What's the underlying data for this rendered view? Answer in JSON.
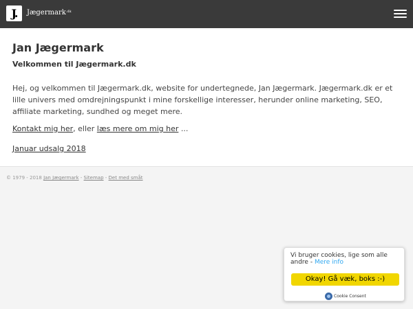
{
  "header": {
    "logo_text": "J.",
    "brand": "Jægermark",
    "brand_suffix": ".dk",
    "menu_icon": "hamburger-icon"
  },
  "main": {
    "title": "Jan Jægermark",
    "subtitle": "Velkommen til Jægermark.dk",
    "intro": "Hej, og velkommen til Jægermark.dk, website for undertegnede, Jan Jægermark. Jægermark.dk er et lille univers med omdrejningspunkt i mine forskellige interesser, herunder online marketing, SEO, affiliate marketing, sundhed og meget mere.",
    "contact_link": "Kontakt mig her",
    "or_text": ", eller ",
    "about_link": "læs mere om mig her",
    "ellipsis": " ...",
    "sale_link": "Januar udsalg 2018"
  },
  "footer": {
    "copyright": "© 1979 - 2018 ",
    "name_link": "Jan Jægermark",
    "sep1": " - ",
    "sitemap_link": "Sitemap",
    "sep2": " - ",
    "fineprint_link": "Det med småt"
  },
  "cookie": {
    "message": "Vi bruger cookies, lige som alle andre - ",
    "more_link": "Mere info",
    "accept_button": "Okay! Gå væk, boks :-)",
    "brand": "Cookie Consent",
    "brand_icon": "cookie-consent-icon"
  },
  "colors": {
    "topbar": "#3a3a3a",
    "button": "#f1d600",
    "more_link": "#31a8f0"
  }
}
